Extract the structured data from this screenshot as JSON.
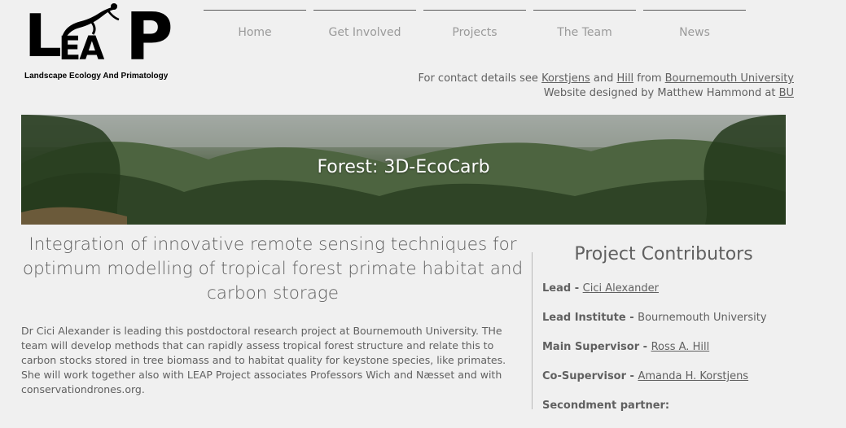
{
  "logo": {
    "letters_l": "L",
    "letters_ea": "EA",
    "letters_p": "P",
    "tagline": "Landscape Ecology And Primatology"
  },
  "nav": {
    "items": [
      {
        "label": "Home"
      },
      {
        "label": "Get Involved"
      },
      {
        "label": "Projects"
      },
      {
        "label": "The Team"
      },
      {
        "label": "News"
      }
    ]
  },
  "contact": {
    "line1_prefix": "For contact details see ",
    "link_korstjens": "Korstjens",
    "and": " and ",
    "link_hill": "Hill",
    "from": " from ",
    "link_bu_full": "Bournemouth University",
    "line2_prefix": "Website designed by Matthew Hammond at ",
    "link_bu": "BU"
  },
  "banner": {
    "title": "Forest: 3D-EcoCarb"
  },
  "project": {
    "headline": "Integration of innovative remote sensing techniques for optimum modelling of tropical forest primate habitat and carbon storage",
    "description": "Dr Cici Alexander is leading this postdoctoral research project at Bournemouth University. THe team will develop methods that can rapidly assess tropical forest structure and relate this to carbon stocks stored in tree biomass and to habitat quality for keystone species, like primates. She will work together also with LEAP Project associates Professors Wich and Næsset and with conservationdrones.org."
  },
  "contributors": {
    "title": "Project Contributors",
    "rows": [
      {
        "role": "Lead - ",
        "name": "Cici Alexander",
        "linked": true
      },
      {
        "role": "Lead Institute - ",
        "name": "Bournemouth University",
        "linked": false
      },
      {
        "role": "Main Supervisor - ",
        "name": "Ross A. Hill",
        "linked": true
      },
      {
        "role": "Co-Supervisor - ",
        "name": "Amanda H. Korstjens",
        "linked": true
      },
      {
        "role": "Secondment partner:",
        "name": "",
        "linked": false
      }
    ]
  },
  "colors": {
    "background": "#f0f0f0",
    "text": "#606060",
    "nav_text": "#9a9a9a",
    "logo": "#000000"
  }
}
